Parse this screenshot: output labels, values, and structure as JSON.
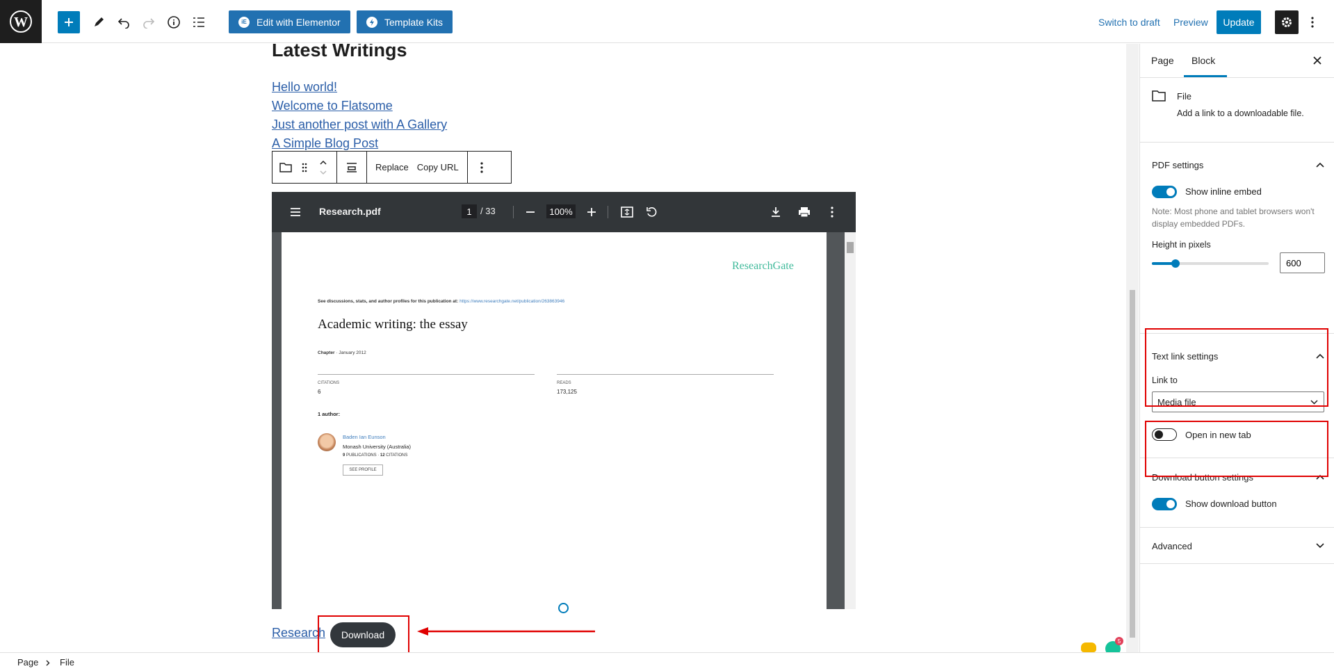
{
  "toolbar": {
    "elementor_label": "Edit with Elementor",
    "elementor_badge": "iE",
    "template_kits_label": "Template Kits",
    "switch_to_draft": "Switch to draft",
    "preview": "Preview",
    "update": "Update"
  },
  "content": {
    "heading": "Latest Writings",
    "posts": [
      "Hello world!",
      "Welcome to Flatsome",
      "Just another post with A Gallery",
      "A Simple Blog Post"
    ],
    "block_toolbar": {
      "replace": "Replace",
      "copy_url": "Copy URL"
    },
    "pdf": {
      "filename": "Research.pdf",
      "page_current": "1",
      "page_total": "/ 33",
      "zoom": "100%",
      "document": {
        "brand": "ResearchGate",
        "discussion_text": "See discussions, stats, and author profiles for this publication at: ",
        "discussion_url": "https://www.researchgate.net/publication/263863946",
        "title": "Academic writing: the essay",
        "chapter_label": "Chapter",
        "chapter_date": " · January 2012",
        "citations_label": "CITATIONS",
        "citations_value": "6",
        "reads_label": "READS",
        "reads_value": "173,125",
        "authors_label": "1 author:",
        "author_name": "Baden Ian Eunson",
        "author_affiliation": "Monash University (Australia)",
        "author_pub_count": "9",
        "author_pub_label": " PUBLICATIONS · ",
        "author_cit_count": "12",
        "author_cit_label": " CITATIONS",
        "see_profile": "SEE PROFILE"
      }
    },
    "file_link": "Research",
    "download_button": "Download"
  },
  "sidebar": {
    "tabs": [
      "Page",
      "Block"
    ],
    "active_tab": "Block",
    "block": {
      "title": "File",
      "description": "Add a link to a downloadable file."
    },
    "pdf_settings": {
      "heading": "PDF settings",
      "show_inline_embed": "Show inline embed",
      "show_inline_embed_on": true,
      "note": "Note: Most phone and tablet browsers won't display embedded PDFs.",
      "height_label": "Height in pixels",
      "height_value": "600",
      "height_slider_fraction": 0.2
    },
    "text_link_settings": {
      "heading": "Text link settings",
      "link_to_label": "Link to",
      "link_to_value": "Media file",
      "open_new_tab": "Open in new tab",
      "open_new_tab_on": false
    },
    "download_button_settings": {
      "heading": "Download button settings",
      "show_download_button": "Show download button",
      "show_download_button_on": true
    },
    "advanced": {
      "heading": "Advanced"
    }
  },
  "footer": {
    "breadcrumbs": [
      "Page",
      "File"
    ]
  },
  "grammarly_badge": "5",
  "colors": {
    "accent": "#007cba",
    "annotation": "#e00000",
    "download_bg": "#32373c",
    "researchgate": "#40ba9b"
  }
}
